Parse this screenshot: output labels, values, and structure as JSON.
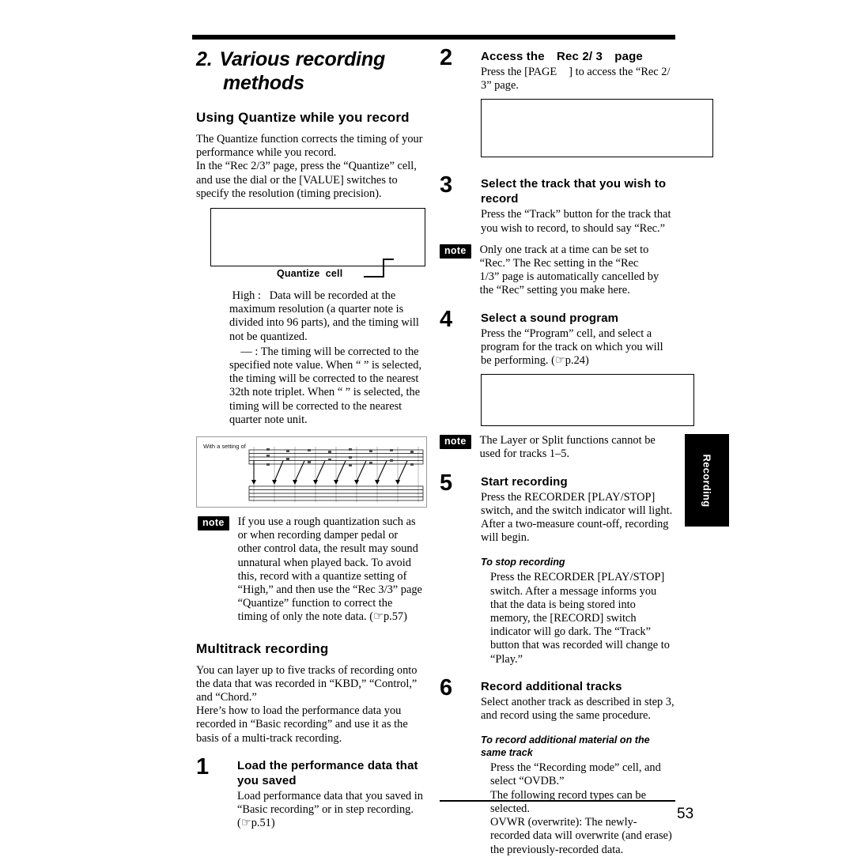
{
  "page": {
    "number": "53",
    "side_tab_label": "Recording"
  },
  "chapter": {
    "number": "2.",
    "title_line1": "Various recording",
    "title_line2": "methods"
  },
  "left_column": {
    "section1": {
      "heading": "Using Quantize while you record",
      "paragraphs": [
        "The Quantize function corrects the timing of your performance while you record.",
        "In the “Rec 2/3” page, press the “Quantize” cell, and use the dial or the [VALUE] switches to specify the resolution (timing precision)."
      ],
      "callout_label": "Quantize  cell",
      "definitions": [
        {
          "term": " High :",
          "text": "Data will be recorded at the maximum resolution (a quarter note is divided into 96 parts), and the timing will not be quantized."
        },
        {
          "term": "— :",
          "text": "The timing will be corrected to the specified note value. When “  ” is selected, the timing will be corrected to the nearest 32th note triplet. When “ ” is selected, the timing will be corrected to the nearest quarter note unit."
        }
      ],
      "figure_caption": "With a setting of",
      "note": "If you use a rough quantization such as   or when recording damper pedal or other control data, the result may sound unnatural when played back. To avoid this, record with a quantize setting of “High,” and then use the “Rec 3/3” page “Quantize” function to correct the timing of only the note data. (☞p.57)",
      "note_badge": "note"
    },
    "section2": {
      "heading": "Multitrack recording",
      "paragraphs": [
        "You can layer up to five tracks of recording onto the data that was recorded in “KBD,” “Control,” and “Chord.”",
        "Here’s how to load the performance data you recorded in “Basic recording” and use it as the basis of a multi-track recording."
      ],
      "step1": {
        "number": "1",
        "title": "Load the performance data that you saved",
        "body": "Load performance data that you saved in “Basic recording” or in step recording. (☞p.51)"
      }
    }
  },
  "right_column": {
    "step2": {
      "number": "2",
      "title_part1": "Access the",
      "title_quoted": "Rec 2/ 3",
      "title_part2": "page",
      "body_part1": "Press the [PAGE",
      "body_part2": "] to access the “Rec 2/ 3” page."
    },
    "step3": {
      "number": "3",
      "title": "Select the track that you wish to record",
      "body": "Press the “Track” button for the track that you wish to record, to should say “Rec.”",
      "note_badge": "note",
      "note": "Only one track at a time can be set to “Rec.” The Rec setting in the “Rec 1/3” page is automatically cancelled by the “Rec” setting you make here."
    },
    "step4": {
      "number": "4",
      "title": "Select a sound program",
      "body": "Press the “Program” cell, and select a program for the track on which you will be performing. (☞p.24)",
      "note_badge": "note",
      "note": "The Layer or Split functions cannot be used for tracks 1–5."
    },
    "step5": {
      "number": "5",
      "title": "Start recording",
      "body": "Press the RECORDER [PLAY/STOP] switch, and the switch indicator will light. After a two-measure count-off, recording will begin.",
      "subhead": "To stop recording",
      "sub_body": "Press the RECORDER [PLAY/STOP] switch. After a message informs you that the data is being stored into memory, the [RECORD] switch indicator will go dark. The “Track” button that was recorded will change to “Play.”"
    },
    "step6": {
      "number": "6",
      "title": "Record additional tracks",
      "body": "Select another track as described in step 3, and record using the same procedure.",
      "subhead": "To record additional material on the same track",
      "sub_body_1": "Press the “Recording mode” cell, and select “OVDB.”",
      "sub_body_2": "The following record types can be selected.",
      "sub_body_3": "OVWR  (overwrite): The newly-recorded data will overwrite (and erase) the previously-recorded data."
    }
  }
}
